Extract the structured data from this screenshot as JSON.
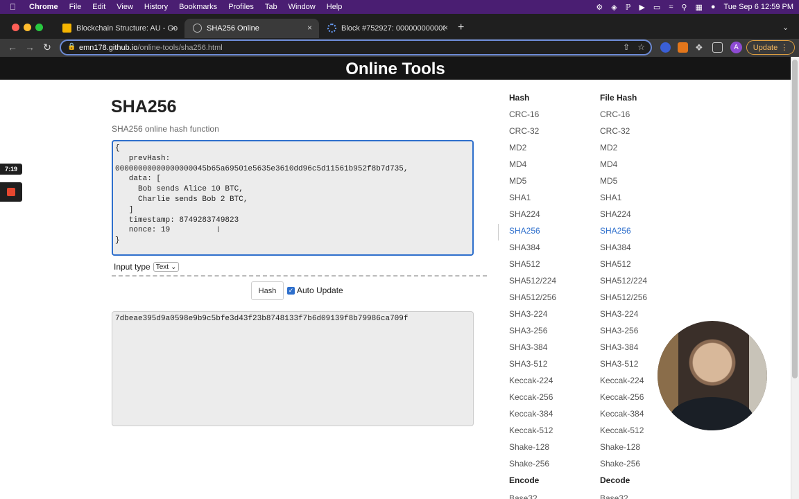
{
  "menubar": {
    "app": "Chrome",
    "items": [
      "File",
      "Edit",
      "View",
      "History",
      "Bookmarks",
      "Profiles",
      "Tab",
      "Window",
      "Help"
    ],
    "clock": "Tue Sep 6  12:59 PM"
  },
  "tabs": [
    {
      "title": "Blockchain Structure: AU - Go",
      "active": false
    },
    {
      "title": "SHA256 Online",
      "active": true
    },
    {
      "title": "Block #752927: 000000000000",
      "active": false
    }
  ],
  "toolbar": {
    "url_host": "emn178.github.io",
    "url_path": "/online-tools/sha256.html",
    "profile_initial": "A",
    "update_label": "Update"
  },
  "site": {
    "banner": "Online Tools"
  },
  "tool": {
    "title": "SHA256",
    "subtitle": "SHA256 online hash function",
    "input_text": "{\n   prevHash:\n00000000000000000045b65a69501e5635e3610dd96c5d11561b952f8b7d735,\n   data: [\n     Bob sends Alice 10 BTC,\n     Charlie sends Bob 2 BTC,\n   ]\n   timestamp: 8749283749823\n   nonce: 19\n}",
    "input_type_label": "Input type",
    "input_type_value": "Text",
    "hash_button": "Hash",
    "auto_update_label": "Auto Update",
    "auto_update_checked": true,
    "output_text": "7dbeae395d9a0598e9b9c5bfe3d43f23b8748133f7b6d09139f8b79986ca709f"
  },
  "sidebar": {
    "hash_heading": "Hash",
    "file_hash_heading": "File Hash",
    "hash_items": [
      "CRC-16",
      "CRC-32",
      "MD2",
      "MD4",
      "MD5",
      "SHA1",
      "SHA224",
      "SHA256",
      "SHA384",
      "SHA512",
      "SHA512/224",
      "SHA512/256",
      "SHA3-224",
      "SHA3-256",
      "SHA3-384",
      "SHA3-512",
      "Keccak-224",
      "Keccak-256",
      "Keccak-384",
      "Keccak-512",
      "Shake-128",
      "Shake-256"
    ],
    "file_hash_items": [
      "CRC-16",
      "CRC-32",
      "MD2",
      "MD4",
      "MD5",
      "SHA1",
      "SHA224",
      "SHA256",
      "SHA384",
      "SHA512",
      "SHA512/224",
      "SHA512/256",
      "SHA3-224",
      "SHA3-256",
      "SHA3-384",
      "SHA3-512",
      "Keccak-224",
      "Keccak-256",
      "Keccak-384",
      "Keccak-512",
      "Shake-128",
      "Shake-256"
    ],
    "active_item": "SHA256",
    "encode_heading": "Encode",
    "decode_heading": "Decode",
    "encode_first": "Base32",
    "decode_first": "Base32"
  },
  "recorder": {
    "timer": "7:19"
  },
  "colors": {
    "menubar_bg": "#4a1e72",
    "accent": "#2e6fcc",
    "banner_bg": "#151515"
  }
}
